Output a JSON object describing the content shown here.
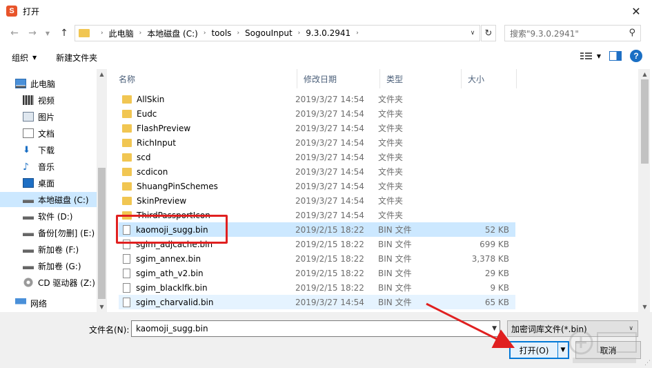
{
  "window": {
    "title": "打开",
    "app_icon_text": "S"
  },
  "nav": {
    "breadcrumb": [
      "此电脑",
      "本地磁盘 (C:)",
      "tools",
      "SogouInput",
      "9.3.0.2941"
    ],
    "search_placeholder": "搜索\"9.3.0.2941\""
  },
  "toolbar": {
    "organize": "组织",
    "new_folder": "新建文件夹"
  },
  "sidebar": {
    "items": [
      {
        "label": "此电脑",
        "icon": "pc-icon"
      },
      {
        "label": "视频",
        "icon": "video-icon"
      },
      {
        "label": "图片",
        "icon": "pictures-icon"
      },
      {
        "label": "文档",
        "icon": "documents-icon"
      },
      {
        "label": "下载",
        "icon": "download-icon"
      },
      {
        "label": "音乐",
        "icon": "music-icon"
      },
      {
        "label": "桌面",
        "icon": "desktop-icon"
      },
      {
        "label": "本地磁盘 (C:)",
        "icon": "drive-icon"
      },
      {
        "label": "软件 (D:)",
        "icon": "drive-icon"
      },
      {
        "label": "备份[勿删] (E:)",
        "icon": "drive-icon"
      },
      {
        "label": "新加卷 (F:)",
        "icon": "drive-icon"
      },
      {
        "label": "新加卷 (G:)",
        "icon": "drive-icon"
      },
      {
        "label": "CD 驱动器 (Z:)",
        "icon": "cd-drive-icon"
      },
      {
        "label": "网络",
        "icon": "network-icon"
      }
    ]
  },
  "list": {
    "columns": [
      "名称",
      "修改日期",
      "类型",
      "大小"
    ],
    "rows": [
      {
        "name": "AllSkin",
        "date": "2019/3/27 14:54",
        "type": "文件夹",
        "size": "",
        "kind": "folder"
      },
      {
        "name": "Eudc",
        "date": "2019/3/27 14:54",
        "type": "文件夹",
        "size": "",
        "kind": "folder"
      },
      {
        "name": "FlashPreview",
        "date": "2019/3/27 14:54",
        "type": "文件夹",
        "size": "",
        "kind": "folder"
      },
      {
        "name": "RichInput",
        "date": "2019/3/27 14:54",
        "type": "文件夹",
        "size": "",
        "kind": "folder"
      },
      {
        "name": "scd",
        "date": "2019/3/27 14:54",
        "type": "文件夹",
        "size": "",
        "kind": "folder"
      },
      {
        "name": "scdicon",
        "date": "2019/3/27 14:54",
        "type": "文件夹",
        "size": "",
        "kind": "folder"
      },
      {
        "name": "ShuangPinSchemes",
        "date": "2019/3/27 14:54",
        "type": "文件夹",
        "size": "",
        "kind": "folder"
      },
      {
        "name": "SkinPreview",
        "date": "2019/3/27 14:54",
        "type": "文件夹",
        "size": "",
        "kind": "folder"
      },
      {
        "name": "ThirdPassportIcon",
        "date": "2019/3/27 14:54",
        "type": "文件夹",
        "size": "",
        "kind": "folder"
      },
      {
        "name": "kaomoji_sugg.bin",
        "date": "2019/2/15 18:22",
        "type": "BIN 文件",
        "size": "52 KB",
        "kind": "file"
      },
      {
        "name": "sgim_adjcache.bin",
        "date": "2019/2/15 18:22",
        "type": "BIN 文件",
        "size": "699 KB",
        "kind": "file"
      },
      {
        "name": "sgim_annex.bin",
        "date": "2019/2/15 18:22",
        "type": "BIN 文件",
        "size": "3,378 KB",
        "kind": "file"
      },
      {
        "name": "sgim_ath_v2.bin",
        "date": "2019/2/15 18:22",
        "type": "BIN 文件",
        "size": "29 KB",
        "kind": "file"
      },
      {
        "name": "sgim_blacklfk.bin",
        "date": "2019/2/15 18:22",
        "type": "BIN 文件",
        "size": "9 KB",
        "kind": "file"
      },
      {
        "name": "sgim_charvalid.bin",
        "date": "2019/3/27 14:54",
        "type": "BIN 文件",
        "size": "65 KB",
        "kind": "file"
      }
    ]
  },
  "bottom": {
    "filename_label": "文件名(N):",
    "filename_value": "kaomoji_sugg.bin",
    "filter_value": "加密词库文件(*.bin)",
    "open_label": "打开(O)",
    "cancel_label": "取消"
  },
  "colors": {
    "selection": "#cce8ff",
    "accent": "#0078d7",
    "annotation": "#e02020"
  }
}
